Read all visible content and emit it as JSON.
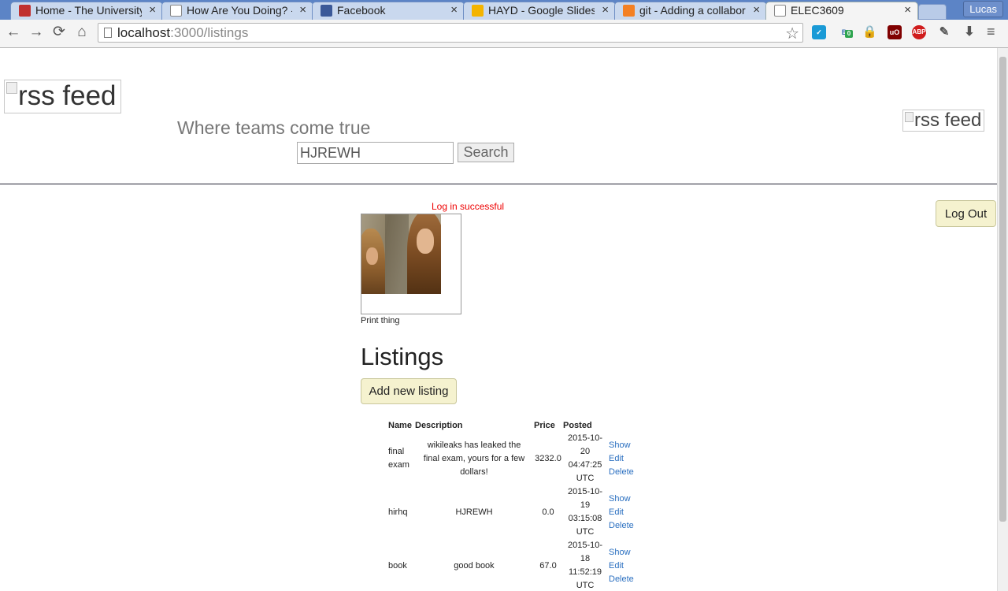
{
  "browser": {
    "tabs": [
      {
        "title": "Home - The University",
        "icon_color": "#c03030",
        "active": false
      },
      {
        "title": "How Are You Doing? - A",
        "icon_color": "#ffffff",
        "active": false
      },
      {
        "title": "Facebook",
        "icon_color": "#3b5998",
        "active": false
      },
      {
        "title": "HAYD - Google Slides",
        "icon_color": "#f4b400",
        "active": false
      },
      {
        "title": "git - Adding a collabora",
        "icon_color": "#f48024",
        "active": false
      },
      {
        "title": "ELEC3609",
        "icon_color": "#ffffff",
        "active": true
      }
    ],
    "tab_close_glyph": "×",
    "user": "Lucas",
    "url_host": "localhost",
    "url_path": ":3000/listings",
    "nav": {
      "back": "←",
      "forward": "→",
      "reload": "⟳",
      "home": "⌂"
    },
    "star": "☆",
    "menu": "≡",
    "extension_badge": "0",
    "extension_labels": {
      "ublock": "uO",
      "adblock": "ABP"
    }
  },
  "header": {
    "logo_left_alt": "rss feed",
    "logo_right_alt": "rss feed",
    "tagline": "Where teams come true",
    "search_value": "HJREWH",
    "search_button": "Search"
  },
  "session": {
    "notice": "Log in successful",
    "logout_label": "Log Out"
  },
  "profile": {
    "caption": "Print thing"
  },
  "listings": {
    "heading": "Listings",
    "add_label": "Add new listing",
    "columns": {
      "name": "Name",
      "description": "Description",
      "price": "Price",
      "posted": "Posted"
    },
    "rows": [
      {
        "name": [
          "final",
          "exam"
        ],
        "description": [
          "wikileaks has leaked the",
          "final exam, yours for a few",
          "dollars!"
        ],
        "price": "3232.0",
        "posted": [
          "2015-10-",
          "20",
          "04:47:25",
          "UTC"
        ],
        "show": "Show",
        "edit": "Edit",
        "delete": "Delete"
      },
      {
        "name": [
          "hirhq"
        ],
        "description": [
          "HJREWH"
        ],
        "price": "0.0",
        "posted": [
          "2015-10-",
          "19",
          "03:15:08",
          "UTC"
        ],
        "show": "Show",
        "edit": "Edit",
        "delete": "Delete"
      },
      {
        "name": [
          "book"
        ],
        "description": [
          "good book"
        ],
        "price": "67.0",
        "posted": [
          "2015-10-",
          "18",
          "11:52:19",
          "UTC"
        ],
        "show": "Show",
        "edit": "Edit",
        "delete": "Delete"
      }
    ]
  }
}
